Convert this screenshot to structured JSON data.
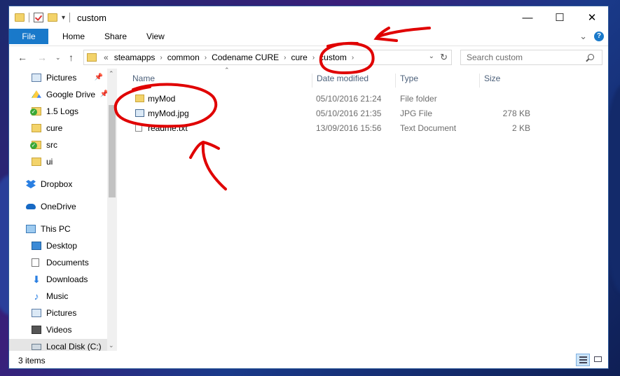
{
  "window": {
    "title": "custom",
    "controls": {
      "minimize": "—",
      "maximize": "☐",
      "close": "✕"
    }
  },
  "ribbon": {
    "tabs": [
      "File",
      "Home",
      "Share",
      "View"
    ],
    "collapse_icon": "⌄",
    "help_icon": "?"
  },
  "address": {
    "overflow": "«",
    "breadcrumbs": [
      "steamapps",
      "common",
      "Codename CURE",
      "cure",
      "custom"
    ],
    "separator": "›"
  },
  "search": {
    "placeholder": "Search custom"
  },
  "nav": {
    "items": [
      {
        "label": "Pictures",
        "icon": "pictures-icon",
        "pinned": true
      },
      {
        "label": "Google Drive",
        "icon": "google-drive-icon",
        "pinned": true
      },
      {
        "label": "1.5 Logs",
        "icon": "synced-folder-icon"
      },
      {
        "label": "cure",
        "icon": "folder-icon"
      },
      {
        "label": "src",
        "icon": "synced-folder-icon"
      },
      {
        "label": "ui",
        "icon": "folder-icon"
      },
      {
        "label": "Dropbox",
        "icon": "dropbox-icon"
      },
      {
        "label": "OneDrive",
        "icon": "onedrive-icon"
      },
      {
        "label": "This PC",
        "icon": "this-pc-icon"
      },
      {
        "label": "Desktop",
        "icon": "desktop-icon"
      },
      {
        "label": "Documents",
        "icon": "documents-icon"
      },
      {
        "label": "Downloads",
        "icon": "downloads-icon"
      },
      {
        "label": "Music",
        "icon": "music-icon"
      },
      {
        "label": "Pictures",
        "icon": "pictures-icon"
      },
      {
        "label": "Videos",
        "icon": "videos-icon"
      },
      {
        "label": "Local Disk (C:)",
        "icon": "local-disk-icon"
      }
    ]
  },
  "columns": [
    "Name",
    "Date modified",
    "Type",
    "Size"
  ],
  "files": [
    {
      "name": "myMod",
      "date": "05/10/2016 21:24",
      "type": "File folder",
      "size": "",
      "icon": "folder-icon"
    },
    {
      "name": "myMod.jpg",
      "date": "05/10/2016 21:35",
      "type": "JPG File",
      "size": "278 KB",
      "icon": "image-file-icon"
    },
    {
      "name": "readme.txt",
      "date": "13/09/2016 15:56",
      "type": "Text Document",
      "size": "2 KB",
      "icon": "text-file-icon"
    }
  ],
  "status": {
    "item_count": "3 items"
  },
  "colors": {
    "accent": "#1979ca",
    "annotation": "#e00000"
  }
}
